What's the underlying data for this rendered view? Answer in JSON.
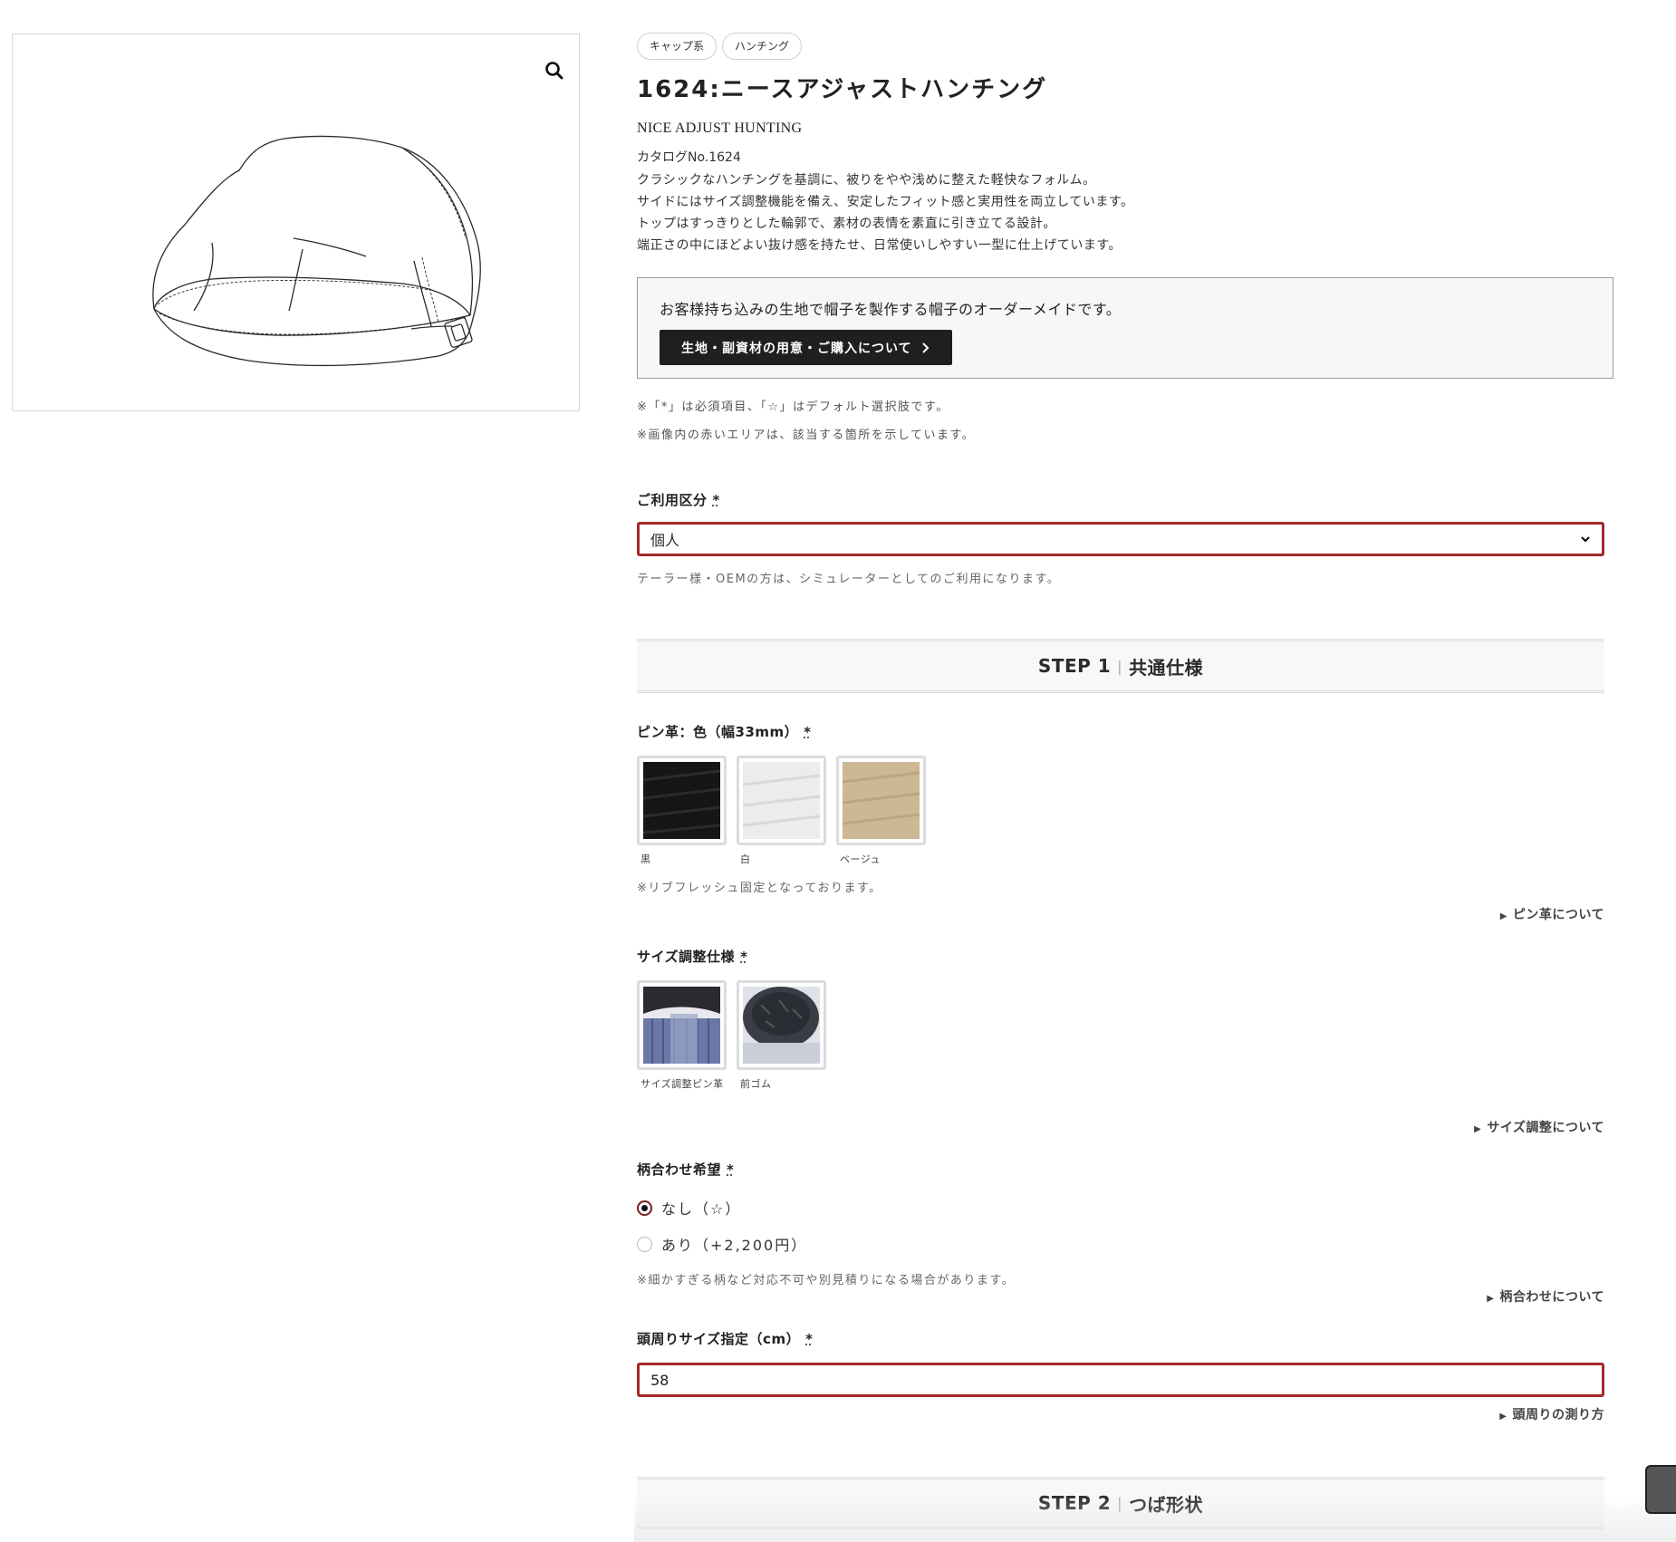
{
  "product": {
    "tags": [
      "キャップ系",
      "ハンチング"
    ],
    "title": "1624:ニースアジャストハンチング",
    "english_name": "NICE ADJUST HUNTING",
    "catalog": "カタログNo.1624",
    "description": [
      "クラシックなハンチングを基調に、被りをやや浅めに整えた軽快なフォルム。",
      "サイドにはサイズ調整機能を備え、安定したフィット感と実用性を両立しています。",
      "トップはすっきりとした輪郭で、素材の表情を素直に引き立てる設計。",
      "端正さの中にほどよい抜け感を持たせ、日常使いしやすい一型に仕上げています。"
    ]
  },
  "notice": {
    "text": "お客様持ち込みの生地で帽子を製作する帽子のオーダーメイドです。",
    "button_label": "生地・副資材の用意・ご購入について"
  },
  "notes": {
    "required": "※「*」は必須項目、「☆」はデフォルト選択肢です。",
    "red_area": "※画像内の赤いエリアは、該当する箇所を示しています。"
  },
  "usage": {
    "label": "ご利用区分",
    "required_mark": "*",
    "selected": "個人",
    "help": "テーラー様・OEMの方は、シミュレーターとしてのご利用になります。"
  },
  "step1": {
    "label": "STEP 1",
    "sep": "|",
    "title": "共通仕様"
  },
  "pin_leather": {
    "label": "ピン革：色（幅33mm）",
    "required_mark": "*",
    "options": [
      {
        "caption": "黒",
        "color": "#1a1a1a"
      },
      {
        "caption": "白",
        "color": "#ececec"
      },
      {
        "caption": "ベージュ",
        "color": "#cdb894"
      }
    ],
    "note": "※リブフレッシュ固定となっております。",
    "about": "ピン革について"
  },
  "size_adjust": {
    "label": "サイズ調整仕様",
    "required_mark": "*",
    "options": [
      {
        "caption": "サイズ調整ピン革"
      },
      {
        "caption": "前ゴム"
      }
    ],
    "about": "サイズ調整について"
  },
  "pattern": {
    "label": "柄合わせ希望",
    "required_mark": "*",
    "options": [
      "なし（☆）",
      "あり（+2,200円）"
    ],
    "selected_index": 0,
    "note": "※細かすぎる柄など対応不可や別見積りになる場合があります。",
    "about": "柄合わせについて"
  },
  "head_size": {
    "label": "頭周りサイズ指定（cm）",
    "required_mark": "*",
    "value": "58",
    "about": "頭周りの測り方"
  },
  "step2": {
    "label": "STEP 2",
    "sep": "|",
    "title": "つば形状"
  },
  "icons": {
    "zoom": "magnifier-icon",
    "chevron": "chevron-down-icon",
    "arrow": "chevron-right-icon",
    "triangle": "triangle-right-icon"
  },
  "colors": {
    "accent_red": "#a5272a",
    "button_dark": "#1f1f1f"
  }
}
